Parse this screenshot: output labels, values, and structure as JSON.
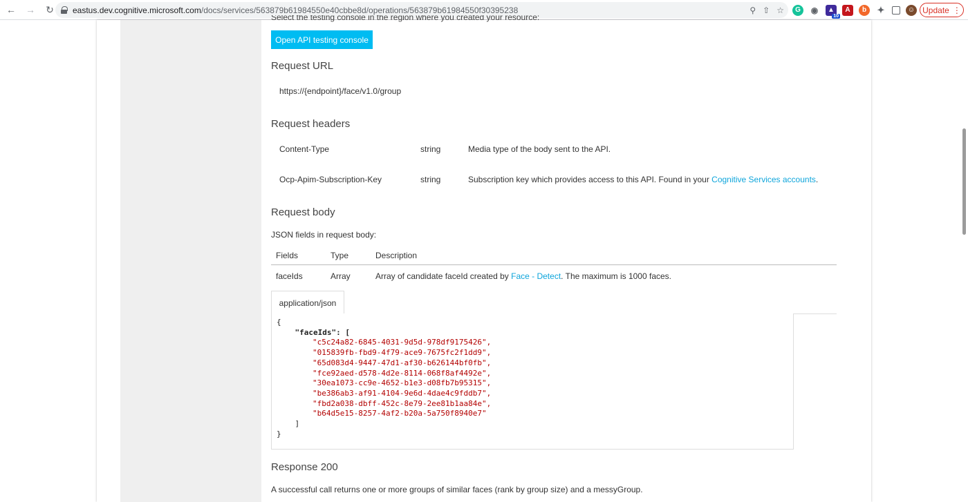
{
  "browser": {
    "url_host": "eastus.dev.cognitive.microsoft.com",
    "url_path": "/docs/services/563879b61984550e40cbbe8d/operations/563879b61984550f30395238",
    "update_label": "Update",
    "ext_badge": "10"
  },
  "page": {
    "cut_text": "Select the testing console in the region where you created your resource:",
    "console_button": "Open API testing console",
    "request_url": {
      "heading": "Request URL",
      "value": "https://{endpoint}/face/v1.0/group"
    },
    "request_headers": {
      "heading": "Request headers",
      "rows": [
        {
          "name": "Content-Type",
          "type": "string",
          "desc": "Media type of the body sent to the API.",
          "link": "",
          "tail": ""
        },
        {
          "name": "Ocp-Apim-Subscription-Key",
          "type": "string",
          "desc": "Subscription key which provides access to this API. Found in your ",
          "link": "Cognitive Services accounts",
          "tail": "."
        }
      ]
    },
    "request_body": {
      "heading": "Request body",
      "intro": "JSON fields in request body:",
      "columns": [
        "Fields",
        "Type",
        "Description"
      ],
      "row": {
        "field": "faceIds",
        "type": "Array",
        "desc_pre": "Array of candidate faceId created by ",
        "link": "Face - Detect",
        "desc_post": ". The maximum is 1000 faces."
      },
      "tab": "application/json",
      "code_open": "{",
      "code_key": "    \"faceIds\": [",
      "face_ids": [
        "\"c5c24a82-6845-4031-9d5d-978df9175426\",",
        "\"015839fb-fbd9-4f79-ace9-7675fc2f1dd9\",",
        "\"65d083d4-9447-47d1-af30-b626144bf0fb\",",
        "\"fce92aed-d578-4d2e-8114-068f8af4492e\",",
        "\"30ea1073-cc9e-4652-b1e3-d08fb7b95315\",",
        "\"be386ab3-af91-4104-9e6d-4dae4c9fddb7\",",
        "\"fbd2a038-dbff-452c-8e79-2ee81b1aa84e\",",
        "\"b64d5e15-8257-4af2-b20a-5a750f8940e7\""
      ],
      "code_close_arr": "    ]",
      "code_close": "}"
    },
    "response": {
      "heading": "Response 200",
      "text": "A successful call returns one or more groups of similar faces (rank by group size) and a messyGroup."
    }
  },
  "colors": {
    "accent": "#00bcf2",
    "link": "#0ea5db",
    "code_string": "#b30000"
  }
}
